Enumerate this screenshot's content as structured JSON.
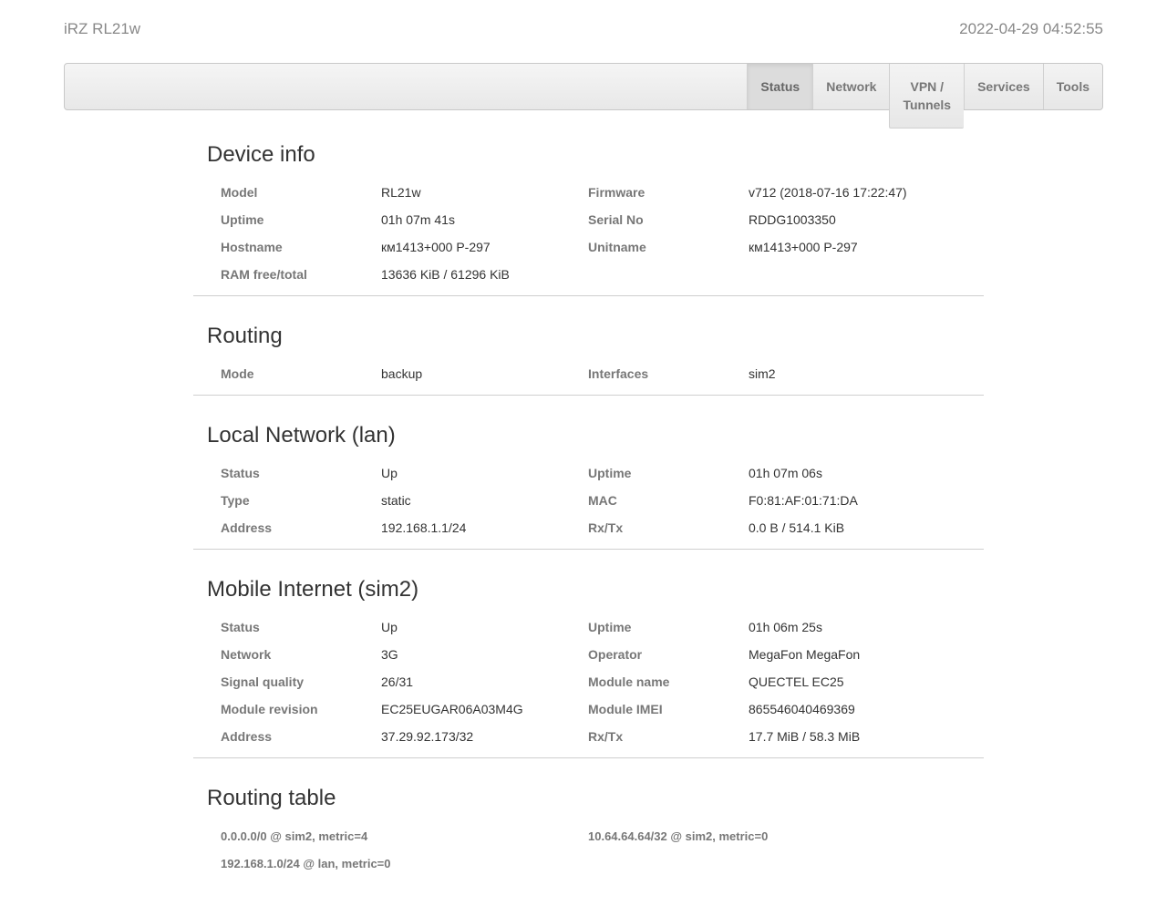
{
  "header": {
    "brand": "iRZ RL21w",
    "datetime": "2022-04-29 04:52:55"
  },
  "nav": {
    "tabs": [
      {
        "label": "Status",
        "active": true
      },
      {
        "label": "Network",
        "active": false
      },
      {
        "label": "VPN /\nTunnels",
        "active": false
      },
      {
        "label": "Services",
        "active": false
      },
      {
        "label": "Tools",
        "active": false
      }
    ]
  },
  "sections": {
    "device_info": {
      "title": "Device info",
      "rows": [
        [
          {
            "label": "Model",
            "value": "RL21w"
          },
          {
            "label": "Firmware",
            "value": "v712 (2018-07-16 17:22:47)"
          }
        ],
        [
          {
            "label": "Uptime",
            "value": "01h 07m 41s"
          },
          {
            "label": "Serial No",
            "value": "RDDG1003350"
          }
        ],
        [
          {
            "label": "Hostname",
            "value": "км1413+000 Р-297"
          },
          {
            "label": "Unitname",
            "value": "км1413+000 Р-297"
          }
        ],
        [
          {
            "label": "RAM free/total",
            "value": "13636 KiB / 61296 KiB"
          }
        ]
      ]
    },
    "routing": {
      "title": "Routing",
      "rows": [
        [
          {
            "label": "Mode",
            "value": "backup"
          },
          {
            "label": "Interfaces",
            "value": "sim2"
          }
        ]
      ]
    },
    "lan": {
      "title": "Local Network (lan)",
      "rows": [
        [
          {
            "label": "Status",
            "value": "Up"
          },
          {
            "label": "Uptime",
            "value": "01h 07m 06s"
          }
        ],
        [
          {
            "label": "Type",
            "value": "static"
          },
          {
            "label": "MAC",
            "value": "F0:81:AF:01:71:DA"
          }
        ],
        [
          {
            "label": "Address",
            "value": "192.168.1.1/24"
          },
          {
            "label": "Rx/Tx",
            "value": "0.0 B / 514.1 KiB"
          }
        ]
      ]
    },
    "mobile": {
      "title": "Mobile Internet (sim2)",
      "rows": [
        [
          {
            "label": "Status",
            "value": "Up"
          },
          {
            "label": "Uptime",
            "value": "01h 06m 25s"
          }
        ],
        [
          {
            "label": "Network",
            "value": "3G"
          },
          {
            "label": "Operator",
            "value": "MegaFon MegaFon"
          }
        ],
        [
          {
            "label": "Signal quality",
            "value": "26/31"
          },
          {
            "label": "Module name",
            "value": "QUECTEL EC25"
          }
        ],
        [
          {
            "label": "Module revision",
            "value": "EC25EUGAR06A03M4G"
          },
          {
            "label": "Module IMEI",
            "value": "865546040469369"
          }
        ],
        [
          {
            "label": "Address",
            "value": "37.29.92.173/32"
          },
          {
            "label": "Rx/Tx",
            "value": "17.7 MiB / 58.3 MiB"
          }
        ]
      ]
    },
    "routing_table": {
      "title": "Routing table",
      "routes": [
        [
          "0.0.0.0/0 @ sim2, metric=4",
          "10.64.64.64/32 @ sim2, metric=0"
        ],
        [
          "192.168.1.0/24 @ lan, metric=0"
        ]
      ]
    }
  }
}
